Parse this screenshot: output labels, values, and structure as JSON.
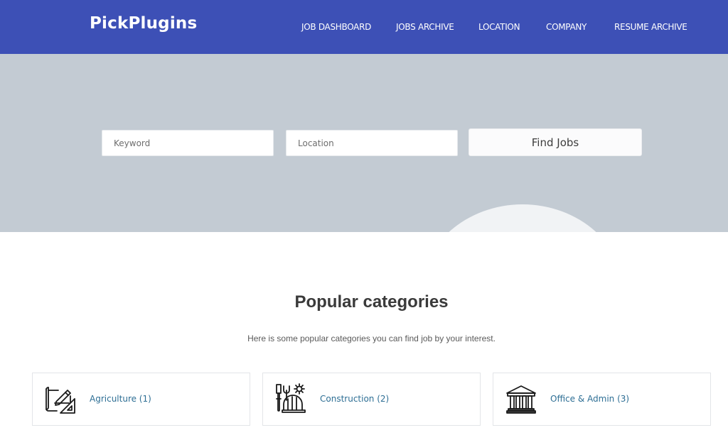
{
  "header": {
    "logo": "PickPlugins",
    "brand_color": "#3d50b6",
    "nav": [
      {
        "label": "JOB DASHBOARD"
      },
      {
        "label": "JOBS ARCHIVE"
      },
      {
        "label": "LOCATION"
      },
      {
        "label": "COMPANY"
      },
      {
        "label": "RESUME ARCHIVE"
      }
    ]
  },
  "search": {
    "keyword_placeholder": "Keyword",
    "keyword_value": "",
    "location_placeholder": "Location",
    "location_value": "",
    "button_label": "Find Jobs"
  },
  "categories": {
    "title": "Popular categories",
    "subtitle": "Here is some popular categories you can find job by your interest.",
    "link_color": "#2d6e94",
    "items": [
      {
        "label": "Agriculture (1)",
        "icon": "blueprint-drafting-icon"
      },
      {
        "label": "Construction (2)",
        "icon": "construction-tools-helmet-icon"
      },
      {
        "label": "Office & Admin (3)",
        "icon": "classical-building-icon"
      }
    ]
  }
}
